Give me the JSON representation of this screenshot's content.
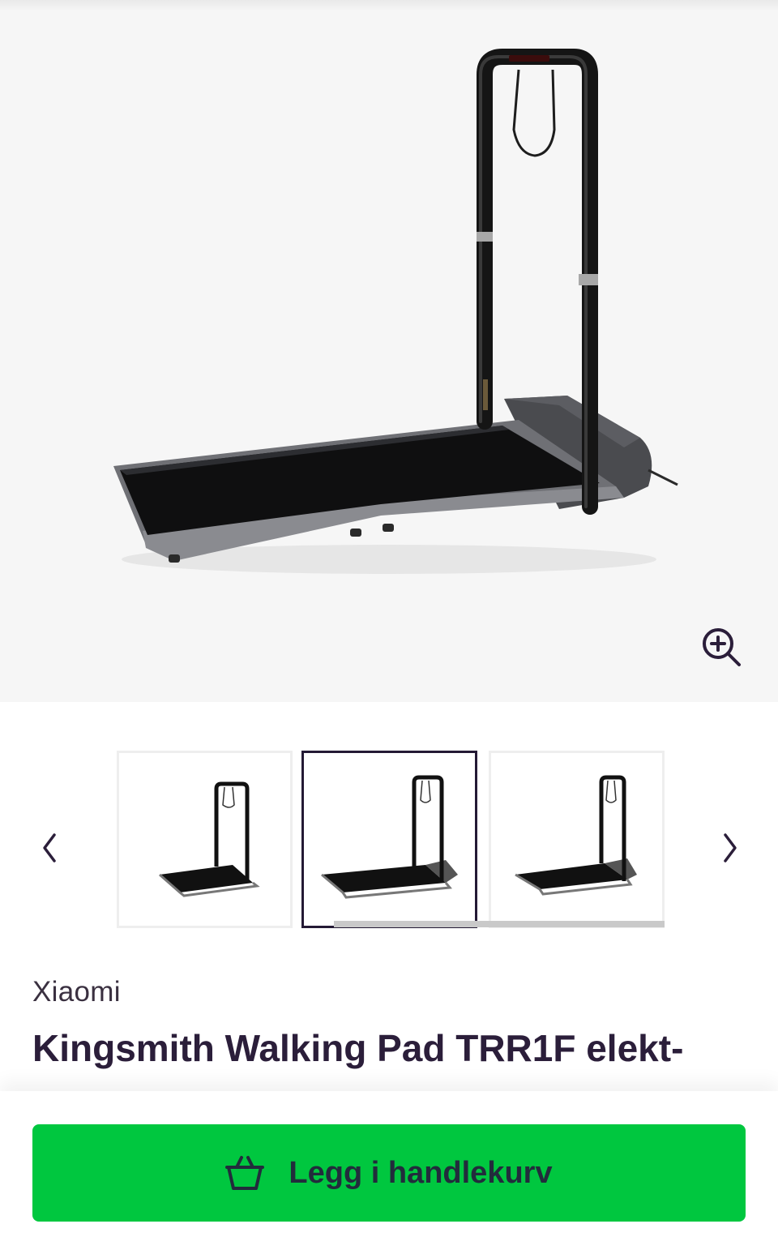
{
  "product": {
    "brand": "Xiaomi",
    "title": "Kingsmith Walking Pad TRR1F elekt-"
  },
  "gallery": {
    "thumbnail_count": 3,
    "selected_index": 1
  },
  "icons": {
    "zoom": "zoom-in-icon",
    "prev": "chevron-left-icon",
    "next": "chevron-right-icon",
    "cart": "basket-icon"
  },
  "actions": {
    "add_to_cart_label": "Legg i handlekurv"
  },
  "colors": {
    "accent": "#00c73f",
    "text_dark": "#2b1e3a",
    "selected_border": "#241a35",
    "hero_bg": "#f6f6f6"
  }
}
